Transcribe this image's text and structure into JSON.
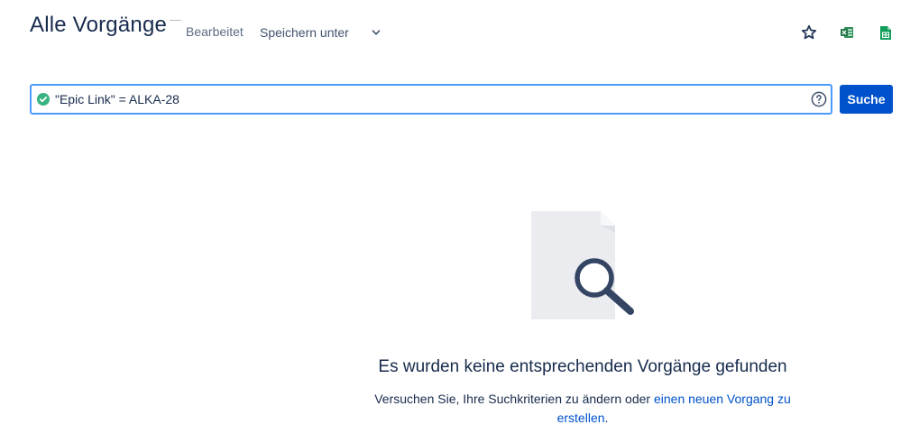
{
  "header": {
    "title": "Alle Vorgänge",
    "edited_label": "Bearbeitet",
    "save_as_label": "Speichern unter"
  },
  "toolbar": {
    "icons": [
      "star-icon",
      "excel-export-icon",
      "sheets-export-icon"
    ]
  },
  "search": {
    "query": "\"Epic Link\" = ALKA-28",
    "status": "valid",
    "button_label": "Suche"
  },
  "empty_state": {
    "title": "Es wurden keine entsprechenden Vorgänge gefunden",
    "text_before": "Versuchen Sie, Ihre Suchkriterien zu ändern oder ",
    "link_text": "einen neuen Vorgang zu erstellen",
    "text_after": "."
  },
  "colors": {
    "primary_blue": "#0052cc",
    "focus_border": "#4c9aff",
    "valid_green": "#36b37e",
    "excel_green": "#1e7145",
    "sheets_green": "#0f9d58",
    "text_dark": "#172b4d"
  }
}
